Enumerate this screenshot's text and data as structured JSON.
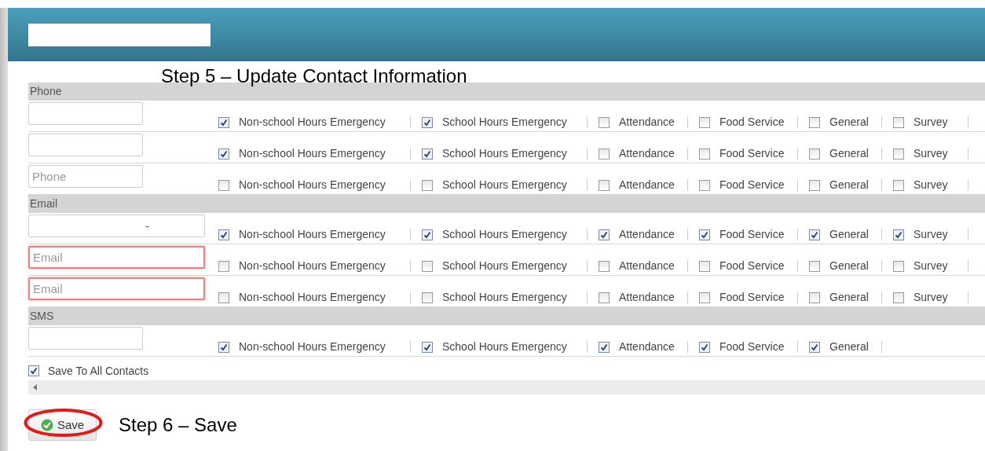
{
  "annotation_step5": "Step 5 – Update Contact Information",
  "sections": [
    {
      "title": "Phone",
      "rows": [
        {
          "invalid": false,
          "wide": false,
          "options": [
            {
              "label": "Non-school Hours Emergency",
              "checked": true
            },
            {
              "label": "School Hours Emergency",
              "checked": true
            },
            {
              "label": "Attendance",
              "checked": false
            },
            {
              "label": "Food Service",
              "checked": false
            },
            {
              "label": "General",
              "checked": false
            },
            {
              "label": "Survey",
              "checked": false
            }
          ]
        },
        {
          "invalid": false,
          "wide": false,
          "options": [
            {
              "label": "Non-school Hours Emergency",
              "checked": true
            },
            {
              "label": "School Hours Emergency",
              "checked": true
            },
            {
              "label": "Attendance",
              "checked": false
            },
            {
              "label": "Food Service",
              "checked": false
            },
            {
              "label": "General",
              "checked": false
            },
            {
              "label": "Survey",
              "checked": false
            }
          ]
        },
        {
          "placeholder": "Phone",
          "invalid": false,
          "wide": false,
          "options": [
            {
              "label": "Non-school Hours Emergency",
              "checked": false
            },
            {
              "label": "School Hours Emergency",
              "checked": false
            },
            {
              "label": "Attendance",
              "checked": false
            },
            {
              "label": "Food Service",
              "checked": false
            },
            {
              "label": "General",
              "checked": false
            },
            {
              "label": "Survey",
              "checked": false
            }
          ]
        }
      ]
    },
    {
      "title": "Email",
      "rows": [
        {
          "value": "-",
          "invalid": false,
          "wide": true,
          "options": [
            {
              "label": "Non-school Hours Emergency",
              "checked": true
            },
            {
              "label": "School Hours Emergency",
              "checked": true
            },
            {
              "label": "Attendance",
              "checked": true
            },
            {
              "label": "Food Service",
              "checked": true
            },
            {
              "label": "General",
              "checked": true
            },
            {
              "label": "Survey",
              "checked": true
            }
          ]
        },
        {
          "placeholder": "Email",
          "invalid": true,
          "wide": true,
          "options": [
            {
              "label": "Non-school Hours Emergency",
              "checked": false
            },
            {
              "label": "School Hours Emergency",
              "checked": false
            },
            {
              "label": "Attendance",
              "checked": false
            },
            {
              "label": "Food Service",
              "checked": false
            },
            {
              "label": "General",
              "checked": false
            },
            {
              "label": "Survey",
              "checked": false
            }
          ]
        },
        {
          "placeholder": "Email",
          "invalid": true,
          "wide": true,
          "options": [
            {
              "label": "Non-school Hours Emergency",
              "checked": false
            },
            {
              "label": "School Hours Emergency",
              "checked": false
            },
            {
              "label": "Attendance",
              "checked": false
            },
            {
              "label": "Food Service",
              "checked": false
            },
            {
              "label": "General",
              "checked": false
            },
            {
              "label": "Survey",
              "checked": false
            }
          ]
        }
      ]
    },
    {
      "title": "SMS",
      "rows": [
        {
          "invalid": false,
          "wide": false,
          "options": [
            {
              "label": "Non-school Hours Emergency",
              "checked": true
            },
            {
              "label": "School Hours Emergency",
              "checked": true
            },
            {
              "label": "Attendance",
              "checked": true
            },
            {
              "label": "Food Service",
              "checked": true
            },
            {
              "label": "General",
              "checked": true
            }
          ]
        }
      ]
    }
  ],
  "save_all": {
    "label": "Save To All Contacts",
    "checked": true
  },
  "save_button": {
    "label": "Save",
    "highlighted": true
  },
  "annotation_step6": "Step 6 – Save"
}
